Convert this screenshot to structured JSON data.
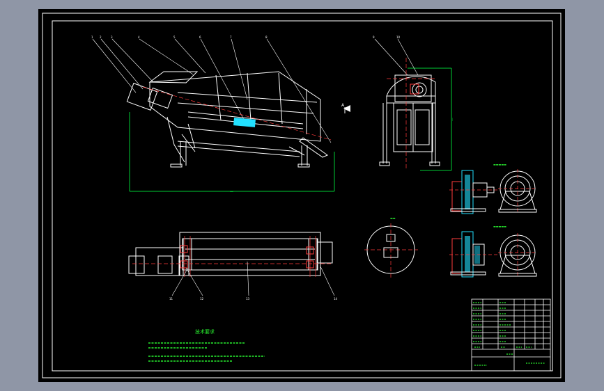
{
  "colors": {
    "viewport_bg": "#8f96a6",
    "sheet_bg": "#000000",
    "frame": "#ffffff",
    "geometry": "#ffffff",
    "parts": "#ff3b3b",
    "dimension": "#00cc33",
    "highlight": "#22e0ff",
    "text_green": "#29f02f"
  },
  "views": {
    "front_view": "side elevation of inclined drum screen",
    "side_view": "end view with drive motor",
    "top_view": "plan view of drum assembly",
    "section_a": "circular section",
    "detail_views": "bearing housing detail views"
  },
  "notes": {
    "heading": "技术要求"
  },
  "title_block": {
    "rows": 10
  }
}
